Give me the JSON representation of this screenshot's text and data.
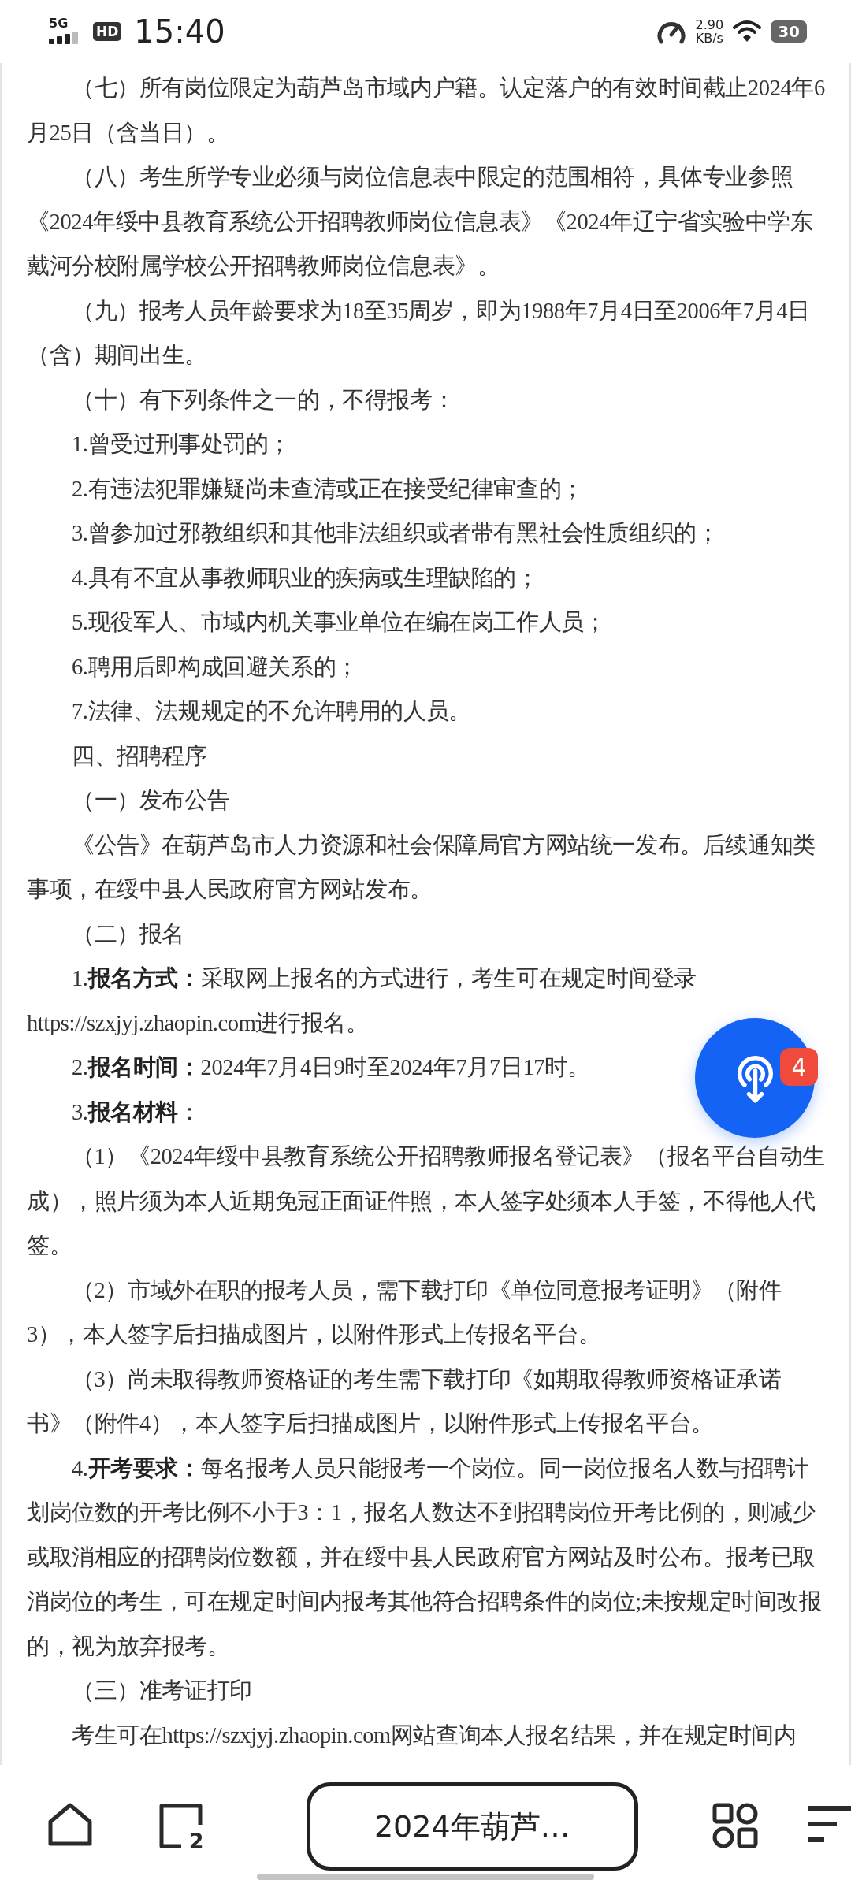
{
  "status_bar": {
    "network": "5G",
    "hd": "HD",
    "time": "15:40",
    "speed_value": "2.90",
    "speed_unit": "KB/s",
    "battery": "30"
  },
  "article": {
    "paragraphs": [
      "（七）所有岗位限定为葫芦岛市域内户籍。认定落户的有效时间截止2024年6月25日（含当日）。",
      "（八）考生所学专业必须与岗位信息表中限定的范围相符，具体专业参照《2024年绥中县教育系统公开招聘教师岗位信息表》《2024年辽宁省实验中学东戴河分校附属学校公开招聘教师岗位信息表》。",
      "（九）报考人员年龄要求为18至35周岁，即为1988年7月4日至2006年7月4日（含）期间出生。",
      "（十）有下列条件之一的，不得报考：",
      "1.曾受过刑事处罚的；",
      "2.有违法犯罪嫌疑尚未查清或正在接受纪律审查的；",
      "3.曾参加过邪教组织和其他非法组织或者带有黑社会性质组织的；",
      "4.具有不宜从事教师职业的疾病或生理缺陷的；",
      "5.现役军人、市域内机关事业单位在编在岗工作人员；",
      "6.聘用后即构成回避关系的；",
      "7.法律、法规规定的不允许聘用的人员。",
      "四、招聘程序",
      "（一）发布公告",
      "《公告》在葫芦岛市人力资源和社会保障局官方网站统一发布。后续通知类事项，在绥中县人民政府官方网站发布。",
      "（二）报名",
      "1.**报名方式：**采取网上报名的方式进行，考生可在规定时间登录https://szxjyj.zhaopin.com进行报名。",
      "2.**报名时间：**2024年7月4日9时至2024年7月7日17时。",
      "3.**报名材料**：",
      "（1）《2024年绥中县教育系统公开招聘教师报名登记表》（报名平台自动生成），照片须为本人近期免冠正面证件照，本人签字处须本人手签，不得他人代签。",
      "（2）市域外在职的报考人员，需下载打印《单位同意报考证明》（附件3），本人签字后扫描成图片，以附件形式上传报名平台。",
      "（3）尚未取得教师资格证的考生需下载打印《如期取得教师资格证承诺书》（附件4），本人签字后扫描成图片，以附件形式上传报名平台。",
      "4.**开考要求：**每名报考人员只能报考一个岗位。同一岗位报名人数与招聘计划岗位数的开考比例不小于3：1，报名人数达不到招聘岗位开考比例的，则减少或取消相应的招聘岗位数额，并在绥中县人民政府官方网站及时公布。报考已取消岗位的考生，可在规定时间内报考其他符合招聘条件的岗位;未按规定时间改报的，视为放弃报考。",
      "（三）准考证打印",
      "考生可在https://szxjyj.zhaopin.com网站查询本人报名结果，并在规定时间内"
    ]
  },
  "floating_button": {
    "badge": "4"
  },
  "bottom_bar": {
    "tab_count": "2",
    "title": "2024年葫芦…"
  }
}
